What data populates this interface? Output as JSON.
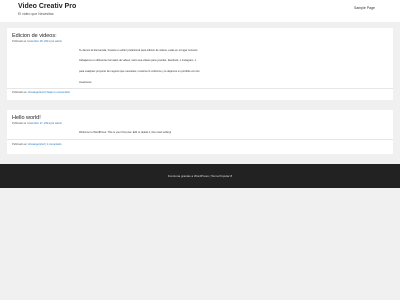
{
  "header": {
    "site_title": "Video Creativ Pro",
    "site_description": "El video que Necesitas",
    "nav_link": "Sample Page"
  },
  "posts": [
    {
      "title": "Edicion de videos:",
      "meta_prefix": "Publicado el",
      "meta_date": "noviembre 18, 2021",
      "meta_by": "por",
      "meta_author": "admin",
      "body": [
        "Te damos la bienvenida, buscas un editor profesional para edicion de videos, estas en el lugar correcto.",
        "trabajamos en diferentes formatos de videos, tanto sea videos para youtube, facebook, o instagram, o",
        "para cualquier proyecto de negocio que necesites, nosotros lo cubrimos y te dejamos un portfolio con los",
        "creaciones"
      ],
      "footer_prefix": "Publicado en",
      "category": "Uncategorized",
      "comment_link": "Dejar un comentario"
    },
    {
      "title": "Hello world!",
      "meta_prefix": "Publicado el",
      "meta_date": "noviembre 17, 2021",
      "meta_by": "por",
      "meta_author": "admin",
      "body": [
        "Welcome to WordPress. This is your first post. Edit or delete it, then start writing!"
      ],
      "footer_prefix": "Publicado en",
      "category": "Uncategorized",
      "comment_link": "1 comentario"
    }
  ],
  "footer": {
    "text": "Funciona gracias a WordPress | Tema Popular 8"
  },
  "colors": {
    "link": "#1e73be",
    "footer_bg": "#222222",
    "page_bg": "#f0f0f0"
  }
}
